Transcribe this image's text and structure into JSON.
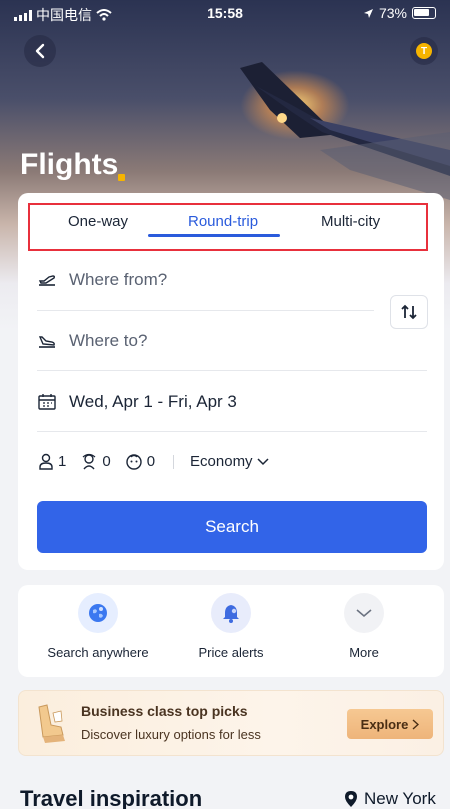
{
  "status_bar": {
    "carrier": "中国电信",
    "time": "15:58",
    "battery": "73%"
  },
  "header": {
    "title": "Flights",
    "avatar_initial": "T"
  },
  "search": {
    "tabs": [
      {
        "label": "One-way",
        "active": false
      },
      {
        "label": "Round-trip",
        "active": true
      },
      {
        "label": "Multi-city",
        "active": false
      }
    ],
    "from_placeholder": "Where from?",
    "to_placeholder": "Where to?",
    "dates": "Wed, Apr 1 - Fri, Apr 3",
    "adults": "1",
    "children": "0",
    "infants": "0",
    "cabin_class": "Economy",
    "search_label": "Search"
  },
  "quick_actions": [
    {
      "label": "Search anywhere",
      "icon": "globe-icon"
    },
    {
      "label": "Price alerts",
      "icon": "bell-icon"
    },
    {
      "label": "More",
      "icon": "chevron-down-icon"
    }
  ],
  "promo": {
    "title": "Business class top picks",
    "subtitle": "Discover luxury options for less",
    "button_label": "Explore"
  },
  "inspiration": {
    "title": "Travel inspiration",
    "location": "New York"
  },
  "colors": {
    "accent": "#3264e8",
    "tab_active": "#2a5bdc",
    "highlight_border": "#e8303c",
    "title_dot": "#f5b400"
  }
}
